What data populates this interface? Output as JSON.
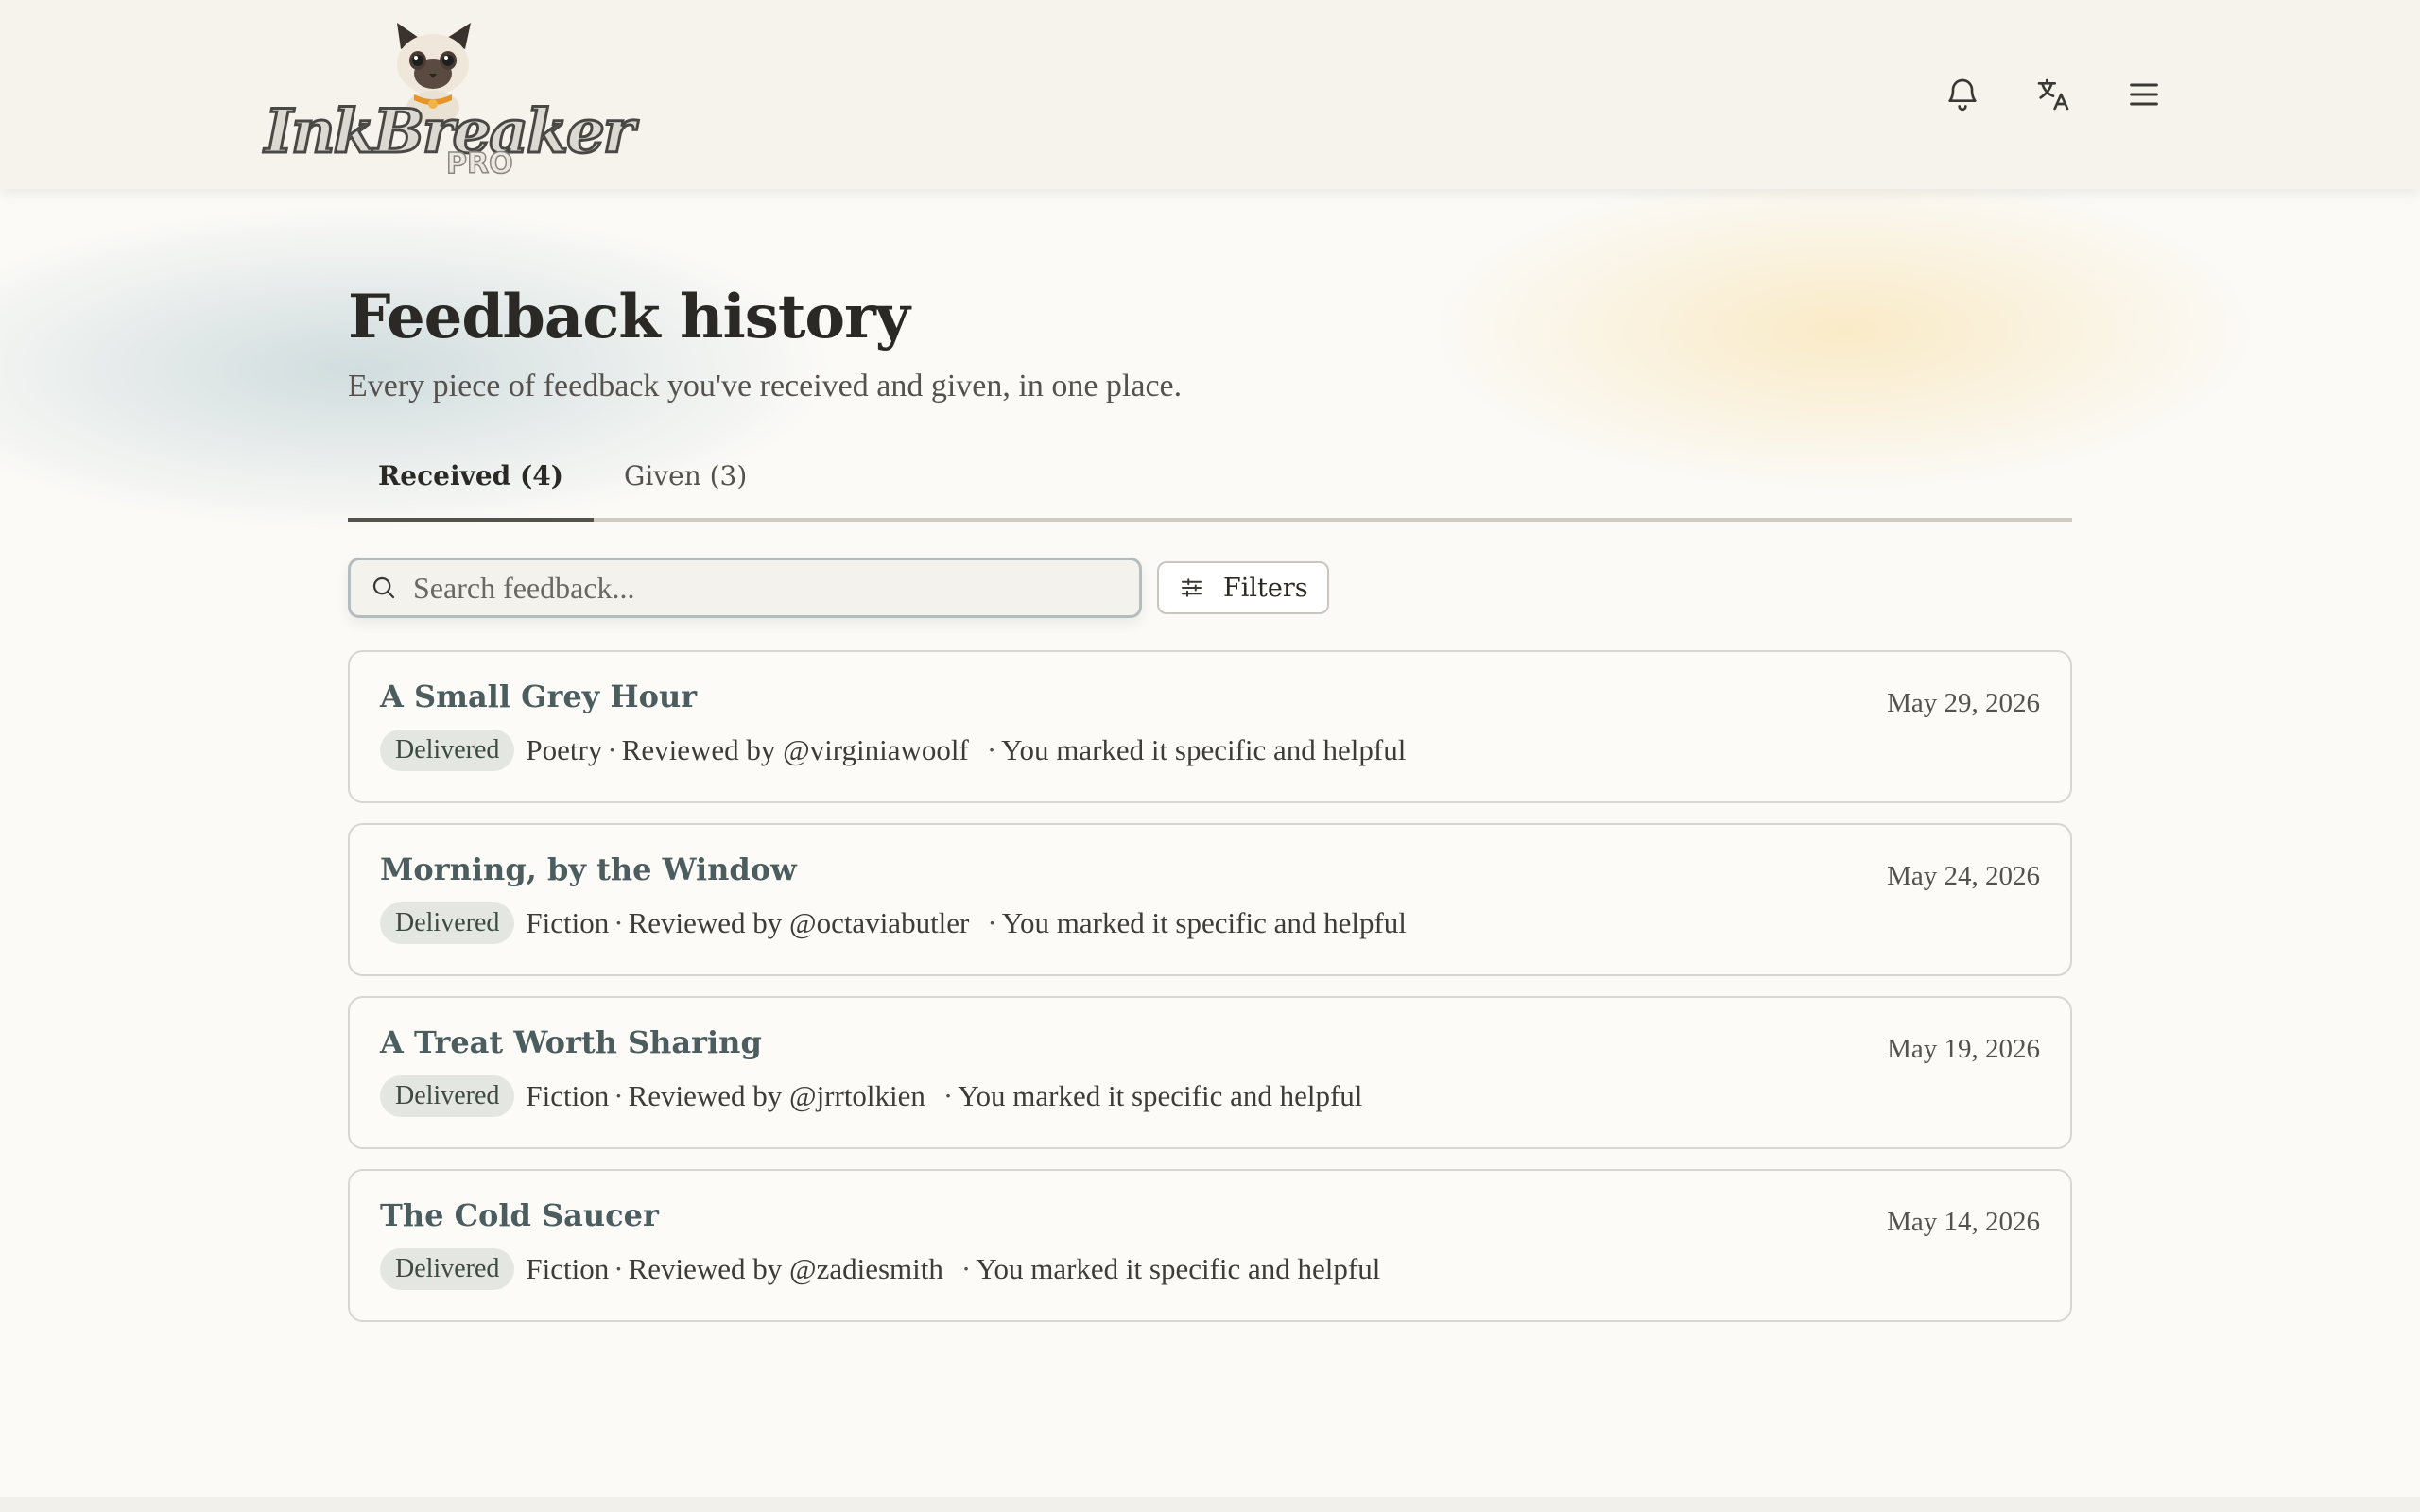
{
  "brand": {
    "name": "InkBreaker",
    "tier": "PRO"
  },
  "header": {
    "icons": [
      "bell-icon",
      "translate-icon",
      "menu-icon"
    ]
  },
  "page": {
    "title": "Feedback history",
    "subtitle": "Every piece of feedback you've received and given, in one place."
  },
  "tabs": [
    {
      "label": "Received (4)",
      "active": true
    },
    {
      "label": "Given (3)",
      "active": false
    }
  ],
  "search": {
    "placeholder": "Search feedback...",
    "value": ""
  },
  "filters": {
    "label": "Filters"
  },
  "feedback": [
    {
      "title": "A Small Grey Hour",
      "date": "May 29, 2026",
      "status": "Delivered",
      "genre": "Poetry",
      "reviewer": "Reviewed by @virginiawoolf",
      "note": "You marked it specific and helpful"
    },
    {
      "title": "Morning, by the Window",
      "date": "May 24, 2026",
      "status": "Delivered",
      "genre": "Fiction",
      "reviewer": "Reviewed by @octaviabutler",
      "note": "You marked it specific and helpful"
    },
    {
      "title": "A Treat Worth Sharing",
      "date": "May 19, 2026",
      "status": "Delivered",
      "genre": "Fiction",
      "reviewer": "Reviewed by @jrrtolkien",
      "note": "You marked it specific and helpful"
    },
    {
      "title": "The Cold Saucer",
      "date": "May 14, 2026",
      "status": "Delivered",
      "genre": "Fiction",
      "reviewer": "Reviewed by @zadiesmith",
      "note": "You marked it specific and helpful"
    }
  ],
  "colors": {
    "background": "#fbfaf7",
    "header": "#f6f3ec",
    "card_title": "#4c5d5f",
    "badge_bg": "#e4e7e1",
    "accent_teal_wash": "#96b4bc",
    "accent_gold_wash": "#f8dea0"
  }
}
